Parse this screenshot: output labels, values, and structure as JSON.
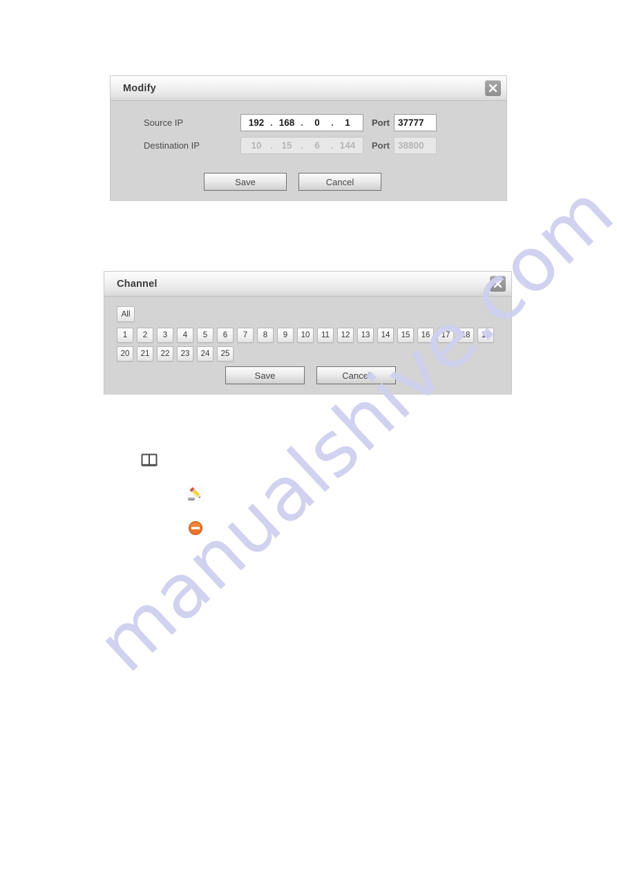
{
  "page": {
    "background_color": "#ffffff",
    "watermark_text": "manualshive.com",
    "watermark_color": "#cfcff0"
  },
  "modify_dialog": {
    "title": "Modify",
    "close_icon": "close-icon",
    "source_ip": {
      "label": "Source IP",
      "octets": [
        "192",
        "168",
        "0",
        "1"
      ],
      "separator": ".",
      "enabled": true,
      "port_label": "Port",
      "port_value": "37777"
    },
    "destination_ip": {
      "label": "Destination IP",
      "octets": [
        "10",
        "15",
        "6",
        "144"
      ],
      "separator": ".",
      "enabled": false,
      "port_label": "Port",
      "port_value": "38800"
    },
    "save_label": "Save",
    "cancel_label": "Cancel"
  },
  "channel_dialog": {
    "title": "Channel",
    "close_icon": "close-icon",
    "all_label": "All",
    "channels": [
      "1",
      "2",
      "3",
      "4",
      "5",
      "6",
      "7",
      "8",
      "9",
      "10",
      "11",
      "12",
      "13",
      "14",
      "15",
      "16",
      "17",
      "18",
      "19",
      "20",
      "21",
      "22",
      "23",
      "24",
      "25"
    ],
    "save_label": "Save",
    "cancel_label": "Cancel"
  },
  "note_icons": [
    {
      "name": "book-note-icon"
    },
    {
      "name": "pencil-edit-icon"
    },
    {
      "name": "delete-forbidden-icon"
    }
  ]
}
